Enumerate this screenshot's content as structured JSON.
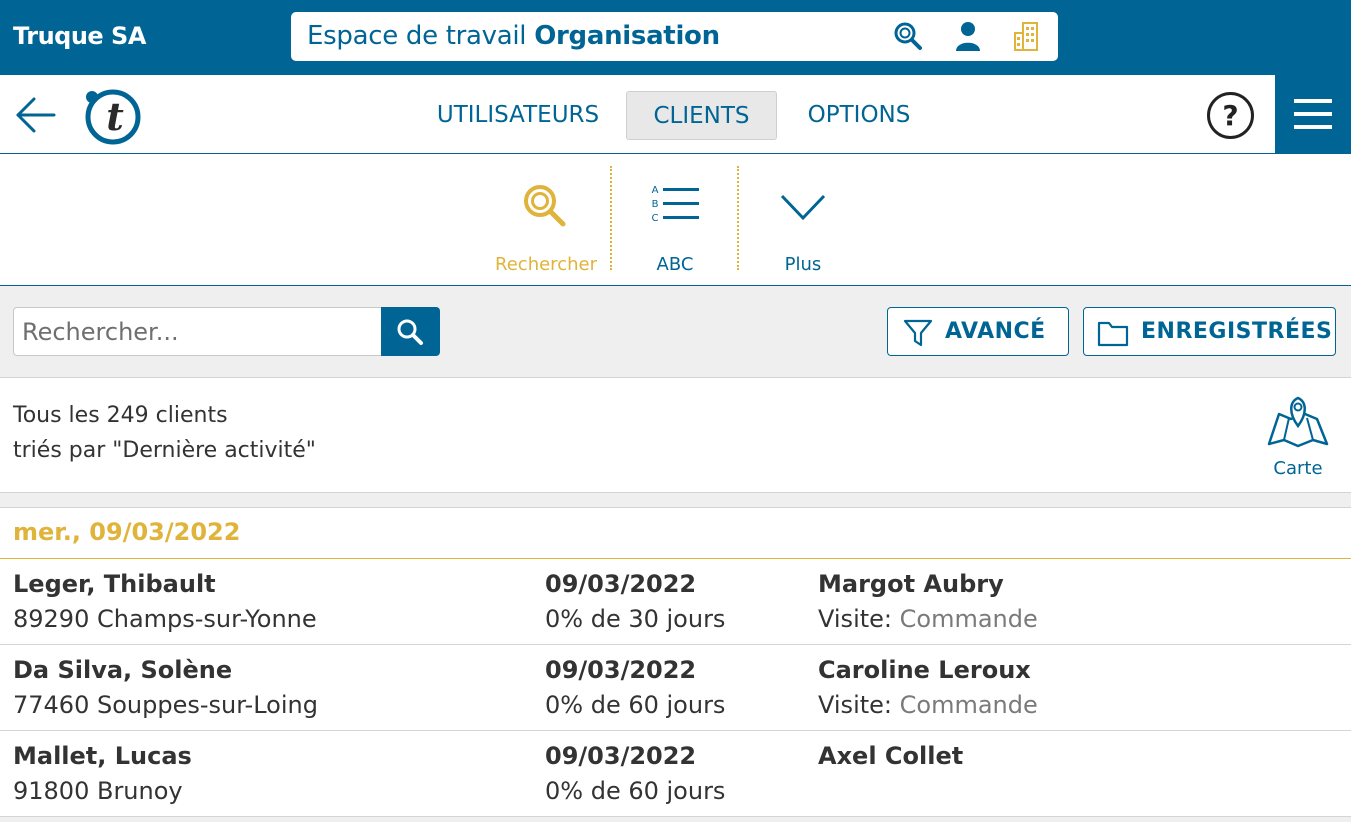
{
  "header": {
    "company": "Truque SA",
    "workspace_prefix": "Espace de travail",
    "workspace_name": "Organisation",
    "icons": [
      "search-icon",
      "user-icon",
      "building-icon"
    ],
    "bg_color": "#006594"
  },
  "nav": {
    "tabs": [
      {
        "label": "UTILISATEURS",
        "active": false
      },
      {
        "label": "CLIENTS",
        "active": true
      },
      {
        "label": "OPTIONS",
        "active": false
      }
    ],
    "help_glyph": "?"
  },
  "toolbar": {
    "items": [
      {
        "label": "Rechercher",
        "icon": "search-icon",
        "active": true
      },
      {
        "label": "ABC",
        "icon": "alphabetical-list-icon",
        "active": false
      },
      {
        "label": "Plus",
        "icon": "chevron-down-icon",
        "active": false
      }
    ],
    "abc_letters": [
      "A",
      "B",
      "C"
    ]
  },
  "search": {
    "placeholder": "Rechercher...",
    "value": "",
    "advanced_label": "AVANCÉ",
    "saved_label": "ENREGISTRÉES"
  },
  "summary": {
    "line1": "Tous les 249 clients",
    "line2": "triés par \"Dernière activité\"",
    "map_label": "Carte"
  },
  "list": {
    "date_header": "mer., 09/03/2022",
    "rows": [
      {
        "name": "Leger, Thibault",
        "address": "89290 Champs-sur-Yonne",
        "date": "09/03/2022",
        "progress": "0% de 30 jours",
        "user": "Margot Aubry",
        "visit_label": "Visite:",
        "visit_value": "Commande"
      },
      {
        "name": "Da Silva, Solène",
        "address": "77460 Souppes-sur-Loing",
        "date": "09/03/2022",
        "progress": "0% de 60 jours",
        "user": "Caroline Leroux",
        "visit_label": "Visite:",
        "visit_value": "Commande"
      },
      {
        "name": "Mallet, Lucas",
        "address": "91800 Brunoy",
        "date": "09/03/2022",
        "progress": "0% de 60 jours",
        "user": "Axel Collet",
        "visit_label": "",
        "visit_value": ""
      }
    ]
  },
  "colors": {
    "primary": "#006594",
    "accent": "#e0b33a",
    "muted_text": "#7a7a7a"
  }
}
